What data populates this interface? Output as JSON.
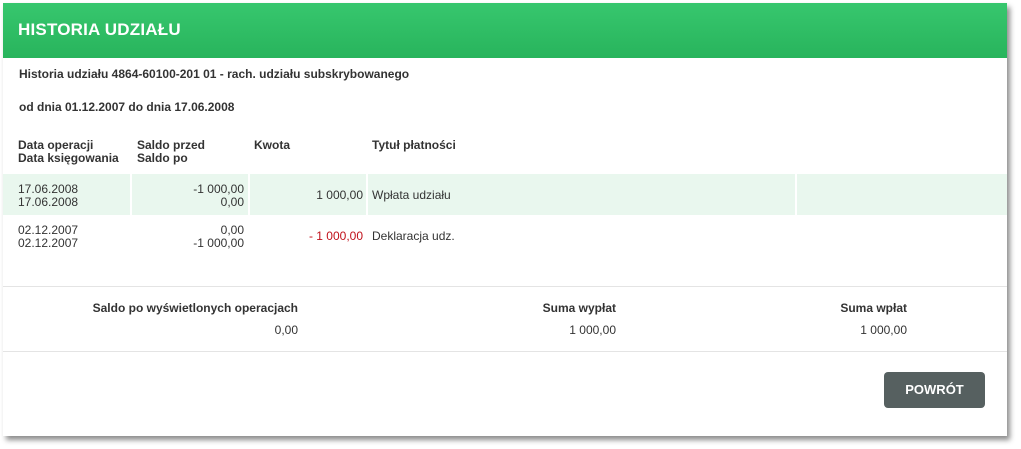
{
  "header": {
    "title": "HISTORIA UDZIAŁU"
  },
  "info": {
    "account_line": "Historia udziału  4864-60100-201 01 - rach. udziału subskrybowanego",
    "date_range": "od dnia 01.12.2007 do dnia 17.06.2008"
  },
  "table": {
    "headers": {
      "date_op": "Data operacji",
      "date_book": "Data księgowania",
      "balance_before": "Saldo przed",
      "balance_after": "Saldo po",
      "amount": "Kwota",
      "title": "Tytuł płatności"
    },
    "rows": [
      {
        "date_op": "17.06.2008",
        "date_book": "17.06.2008",
        "balance_before": "-1 000,00",
        "balance_after": "0,00",
        "amount": "1 000,00",
        "title": "Wpłata udziału"
      },
      {
        "date_op": "02.12.2007",
        "date_book": "02.12.2007",
        "balance_before": "0,00",
        "balance_after": "-1 000,00",
        "amount": "- 1 000,00",
        "title": "Deklaracja udz."
      }
    ]
  },
  "summary": {
    "balance_label": "Saldo po wyświetlonych operacjach",
    "balance_value": "0,00",
    "withdrawals_label": "Suma wypłat",
    "withdrawals_value": "1 000,00",
    "deposits_label": "Suma wpłat",
    "deposits_value": "1 000,00"
  },
  "buttons": {
    "back": "POWRÓT"
  },
  "colors": {
    "header_green": "#2fbf66",
    "row_highlight": "#e9f7ee",
    "negative_amount": "#c0101a",
    "button_bg": "#566060"
  }
}
